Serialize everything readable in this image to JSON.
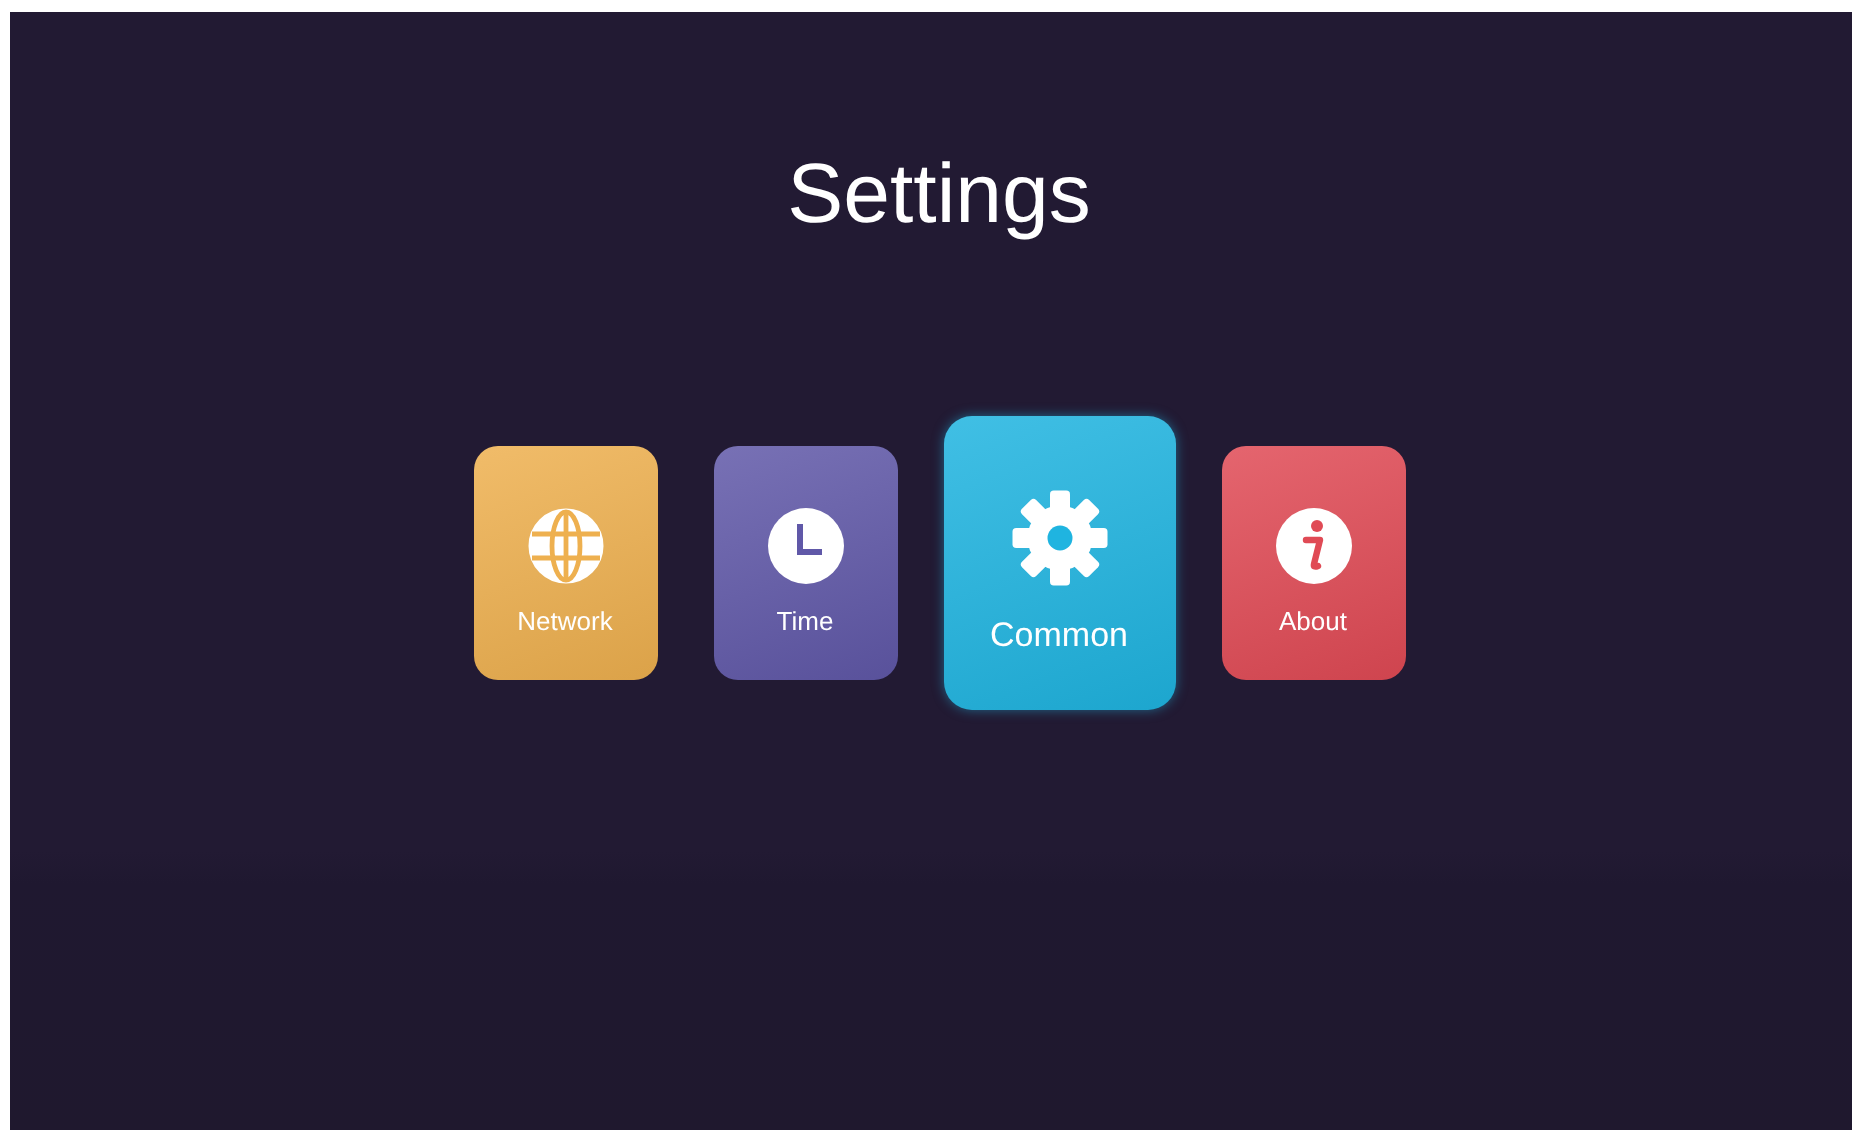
{
  "title": "Settings",
  "tiles": [
    {
      "label": "Network",
      "kind": "globe",
      "color": "#eeb04f",
      "selected": false
    },
    {
      "label": "Time",
      "kind": "clock",
      "color": "#6058a8",
      "selected": false
    },
    {
      "label": "Common",
      "kind": "gear",
      "color": "#1fb4e0",
      "selected": true
    },
    {
      "label": "About",
      "kind": "info",
      "color": "#e04a55",
      "selected": false
    }
  ]
}
